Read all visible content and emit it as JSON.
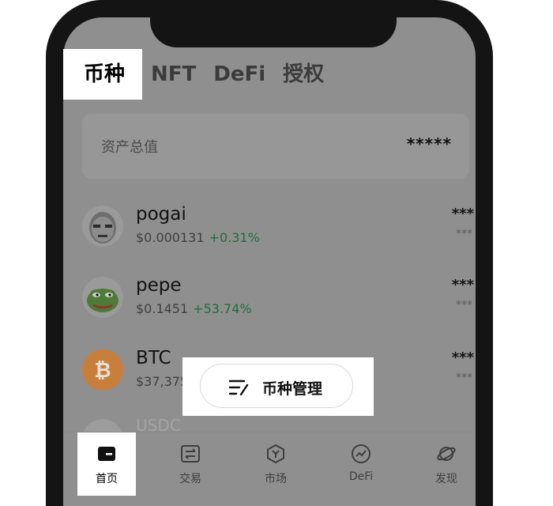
{
  "tabs": [
    {
      "label": "币种",
      "active": true
    },
    {
      "label": "NFT",
      "active": false
    },
    {
      "label": "DeFi",
      "active": false
    },
    {
      "label": "授权",
      "active": false
    }
  ],
  "asset_total": {
    "label": "资产总值",
    "value": "*****"
  },
  "coins": [
    {
      "name": "pogai",
      "price": "$0.000131",
      "change": "+0.31%",
      "amount": "***",
      "fiat": "***",
      "icon": "pogai-coin-icon"
    },
    {
      "name": "pepe",
      "price": "$0.1451",
      "change": "+53.74%",
      "amount": "***",
      "fiat": "***",
      "icon": "pepe-coin-icon"
    },
    {
      "name": "BTC",
      "price": "$37,375.4",
      "change": "",
      "amount": "***",
      "fiat": "***",
      "icon": "btc-coin-icon"
    }
  ],
  "faded_row": "USDC",
  "manage_button": {
    "label": "币种管理",
    "icon": "list-edit-icon"
  },
  "nav": [
    {
      "label": "首页",
      "icon": "wallet-icon",
      "active": true
    },
    {
      "label": "交易",
      "icon": "swap-icon",
      "active": false
    },
    {
      "label": "市场",
      "icon": "market-icon",
      "active": false
    },
    {
      "label": "DeFi",
      "icon": "defi-chart-icon",
      "active": false
    },
    {
      "label": "发现",
      "icon": "planet-icon",
      "active": false
    }
  ],
  "colors": {
    "dim_overlay": "#8f8f8f",
    "positive_change": "#1f6e3a",
    "btc": "#e59a45",
    "pepe": "#5a8a3a"
  }
}
